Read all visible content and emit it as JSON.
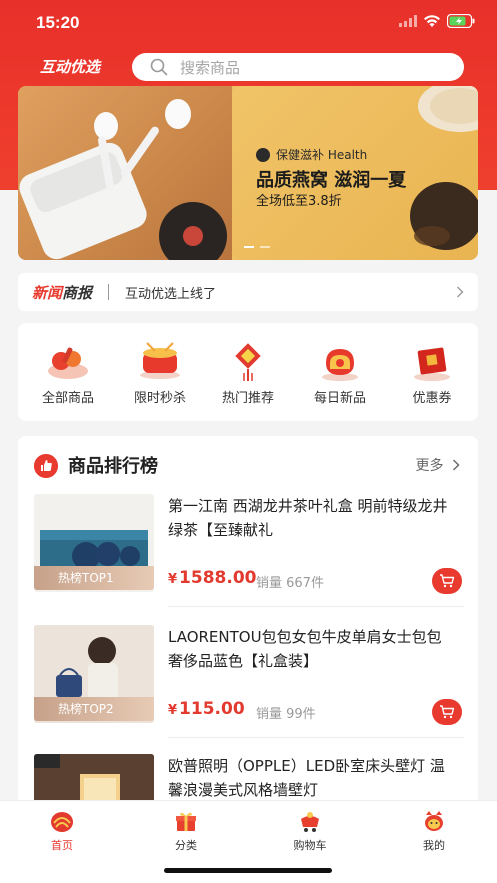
{
  "status_bar": {
    "time": "15:20"
  },
  "header": {
    "app_title": "互动优选",
    "search_placeholder": "搜索商品"
  },
  "banner": {
    "tag": "保健滋补 Health",
    "headline": "品质燕窝 滋润一夏",
    "sub": "全场低至3.8折"
  },
  "news": {
    "brand_red": "新闻",
    "brand_dark": "商报",
    "text": "互动优选上线了"
  },
  "categories": [
    {
      "label": "全部商品",
      "icon": "food-platter-icon"
    },
    {
      "label": "限时秒杀",
      "icon": "drum-icon"
    },
    {
      "label": "热门推荐",
      "icon": "chinese-knot-icon"
    },
    {
      "label": "每日新品",
      "icon": "money-bag-icon"
    },
    {
      "label": "优惠券",
      "icon": "red-envelope-icon"
    }
  ],
  "ranking": {
    "title": "商品排行榜",
    "more": "更多",
    "products": [
      {
        "name": "第一江南 西湖龙井茶叶礼盒 明前特级龙井绿茶【至臻献礼",
        "price": "1588.00",
        "sales": "销量 667件",
        "hot_tag": "热榜TOP1"
      },
      {
        "name": "LAORENTOU包包女包牛皮单肩女士包包奢侈品蓝色【礼盒装】",
        "price": "115.00",
        "sales": "销量 99件",
        "hot_tag": "热榜TOP2"
      },
      {
        "name": "欧普照明（OPPLE）LED卧室床头壁灯 温馨浪漫美式风格墙壁灯",
        "price": "",
        "sales": "",
        "hot_tag": ""
      }
    ],
    "currency": "¥"
  },
  "tabbar": [
    {
      "label": "首页",
      "icon": "home-icon",
      "active": true
    },
    {
      "label": "分类",
      "icon": "gift-box-icon",
      "active": false
    },
    {
      "label": "购物车",
      "icon": "shopping-cart-icon",
      "active": false
    },
    {
      "label": "我的",
      "icon": "profile-icon",
      "active": false
    }
  ],
  "colors": {
    "brand_red": "#e83a2e",
    "banner_gold": "#efbf63"
  }
}
